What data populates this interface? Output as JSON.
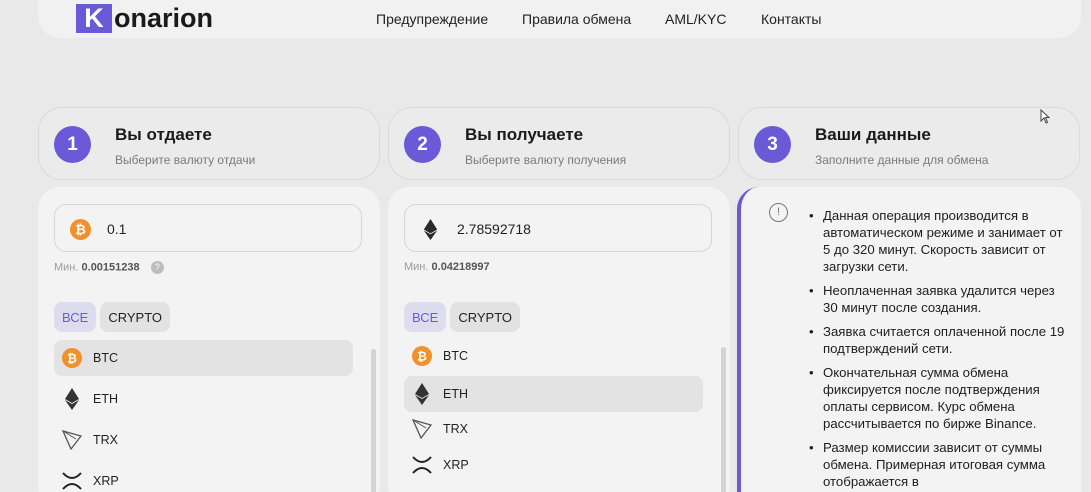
{
  "header": {
    "logo_letter": "K",
    "logo_rest": "onarion",
    "nav": [
      "Предупреждение",
      "Правила обмена",
      "AML/KYC",
      "Контакты"
    ]
  },
  "steps": [
    {
      "num": "1",
      "title": "Вы отдаете",
      "subtitle": "Выберите валюту отдачи"
    },
    {
      "num": "2",
      "title": "Вы получаете",
      "subtitle": "Выберите валюту получения"
    },
    {
      "num": "3",
      "title": "Ваши данные",
      "subtitle": "Заполните данные для обмена"
    }
  ],
  "give": {
    "coin_icon": "bitcoin-icon",
    "amount": "0.1",
    "min_label": "Мин.",
    "min_value": "0.00151238",
    "filters": [
      "ВСЕ",
      "CRYPTO"
    ],
    "coins": [
      "BTC",
      "ETH",
      "TRX",
      "XRP"
    ],
    "selected": "BTC"
  },
  "receive": {
    "coin_icon": "ethereum-icon",
    "amount": "2.78592718",
    "min_label": "Мин.",
    "min_value": "0.04218997",
    "filters": [
      "ВСЕ",
      "CRYPTO"
    ],
    "coins": [
      "BTC",
      "ETH",
      "TRX",
      "XRP"
    ],
    "selected": "ETH"
  },
  "notes": [
    "Данная операция производится в автоматическом режиме и занимает от 5 до 320 минут. Скорость зависит от загрузки сети.",
    "Неоплаченная заявка удалится через 30 минут после создания.",
    "Заявка считается оплаченной после 19 подтверждений сети.",
    "Окончательная сумма обмена фиксируется после подтверждения оплаты сервисом. Курс обмена рассчитывается по бирже Binance.",
    "Размер комиссии зависит от суммы обмена. Примерная итоговая сумма отображается в"
  ],
  "colors": {
    "accent": "#6a5ad8",
    "btc": "#f0912b",
    "background": "#e9e9e9"
  }
}
